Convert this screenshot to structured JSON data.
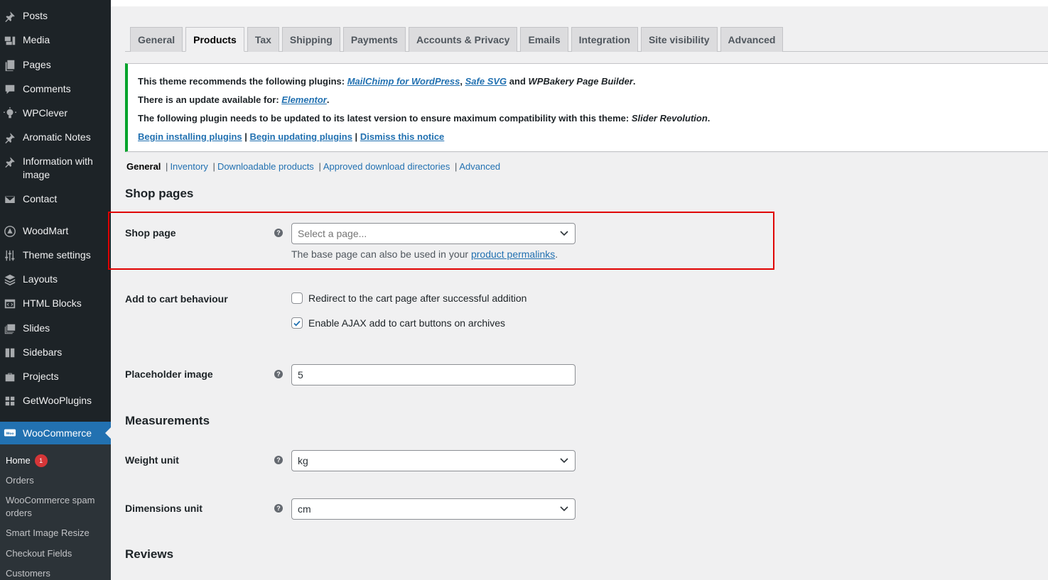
{
  "sidebar": {
    "items": [
      {
        "label": "Posts",
        "icon": "pin-icon"
      },
      {
        "label": "Media",
        "icon": "media-icon"
      },
      {
        "label": "Pages",
        "icon": "pages-icon"
      },
      {
        "label": "Comments",
        "icon": "comments-icon"
      },
      {
        "label": "WPClever",
        "icon": "lightbulb-icon"
      },
      {
        "label": "Aromatic Notes",
        "icon": "pin-icon"
      },
      {
        "label": "Information with image",
        "icon": "pin-icon"
      },
      {
        "label": "Contact",
        "icon": "mail-icon"
      },
      {
        "label": "WoodMart",
        "icon": "woodmart-icon"
      },
      {
        "label": "Theme settings",
        "icon": "sliders-icon"
      },
      {
        "label": "Layouts",
        "icon": "layers-icon"
      },
      {
        "label": "HTML Blocks",
        "icon": "code-icon"
      },
      {
        "label": "Slides",
        "icon": "slides-icon"
      },
      {
        "label": "Sidebars",
        "icon": "sidebar-icon"
      },
      {
        "label": "Projects",
        "icon": "briefcase-icon"
      },
      {
        "label": "GetWooPlugins",
        "icon": "grid-icon"
      },
      {
        "label": "WooCommerce",
        "icon": "woo-icon"
      }
    ],
    "submenu": [
      {
        "label": "Home",
        "badge": "1"
      },
      {
        "label": "Orders"
      },
      {
        "label": "WooCommerce spam orders"
      },
      {
        "label": "Smart Image Resize"
      },
      {
        "label": "Checkout Fields"
      },
      {
        "label": "Customers"
      }
    ]
  },
  "tabs": [
    "General",
    "Products",
    "Tax",
    "Shipping",
    "Payments",
    "Accounts & Privacy",
    "Emails",
    "Integration",
    "Site visibility",
    "Advanced"
  ],
  "active_tab": "Products",
  "notice": {
    "line1_prefix": "This theme recommends the following plugins: ",
    "plugin1": "MailChimp for WordPress",
    "sep1": ", ",
    "plugin2": "Safe SVG",
    "and": " and ",
    "plugin3": "WPBakery Page Builder",
    "period": ".",
    "line2_prefix": "There is an update available for: ",
    "update_plugin": "Elementor",
    "line3_prefix": "The following plugin needs to be updated to its latest version to ensure maximum compatibility with this theme: ",
    "line3_plugin": "Slider Revolution",
    "link_begin_installing": "Begin installing plugins",
    "link_begin_updating": "Begin updating plugins",
    "link_dismiss": "Dismiss this notice",
    "link_sep": " | "
  },
  "subnav": {
    "current": "General",
    "links": [
      "Inventory",
      "Downloadable products",
      "Approved download directories",
      "Advanced"
    ],
    "sep": "|"
  },
  "shop_pages": {
    "heading": "Shop pages",
    "shop_page_label": "Shop page",
    "shop_page_placeholder": "Select a page...",
    "desc_prefix": "The base page can also be used in your ",
    "desc_link": "product permalinks",
    "desc_suffix": ".",
    "add_to_cart_label": "Add to cart behaviour",
    "redirect_label": "Redirect to the cart page after successful addition",
    "redirect_checked": false,
    "ajax_label": "Enable AJAX add to cart buttons on archives",
    "ajax_checked": true,
    "placeholder_image_label": "Placeholder image",
    "placeholder_image_value": "5"
  },
  "measurements": {
    "heading": "Measurements",
    "weight_label": "Weight unit",
    "weight_value": "kg",
    "dimensions_label": "Dimensions unit",
    "dimensions_value": "cm"
  },
  "reviews": {
    "heading": "Reviews"
  },
  "help_glyph": "?",
  "colors": {
    "admin_bar": "#1d2327",
    "accent": "#2271b1",
    "notice_border": "#00a32a",
    "highlight": "#e00000",
    "badge": "#d63638"
  }
}
